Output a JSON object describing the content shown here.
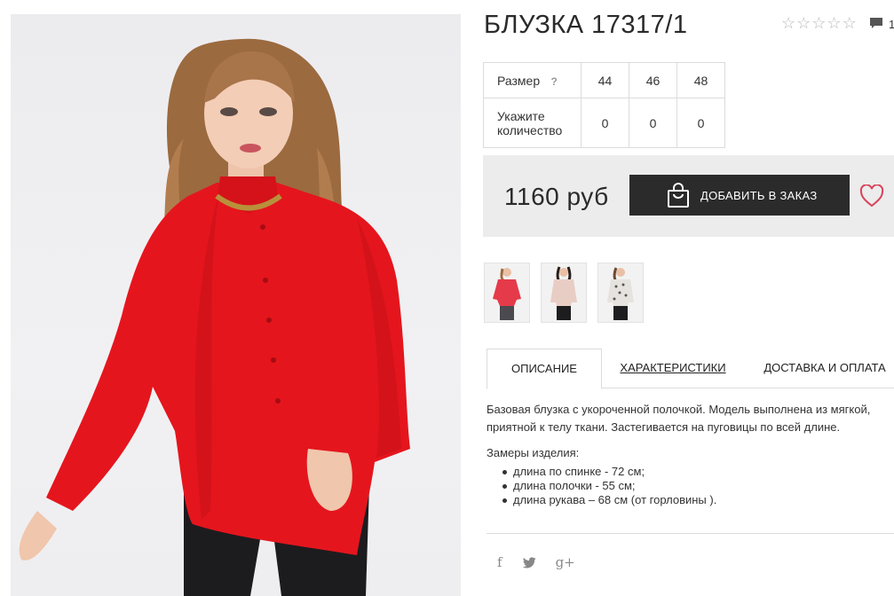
{
  "product": {
    "title": "БЛУЗКА 17317/1",
    "rating_stars": 5,
    "rating_filled": 0,
    "comment_count": "1"
  },
  "sizes": {
    "size_label": "Размер",
    "help_symbol": "?",
    "qty_label": "Укажите количество",
    "values": [
      "44",
      "46",
      "48"
    ],
    "quantities": [
      "0",
      "0",
      "0"
    ]
  },
  "purchase": {
    "price": "1160 руб",
    "add_button": "ДОБАВИТЬ В ЗАКАЗ"
  },
  "thumbnails": [
    {
      "name": "thumb-red-blouse"
    },
    {
      "name": "thumb-beige-blouse"
    },
    {
      "name": "thumb-printed-blouse"
    }
  ],
  "tabs": [
    {
      "label": "ОПИСАНИЕ",
      "active": true
    },
    {
      "label": "ХАРАКТЕРИСТИКИ",
      "active": false
    },
    {
      "label": "ДОСТАВКА И ОПЛАТА",
      "active": false
    }
  ],
  "description": {
    "text": "Базовая блузка с укороченной полочкой. Модель выполнена из мягкой, приятной к телу ткани. Застегивается на пуговицы по всей длине.",
    "measures_title": "Замеры изделия:",
    "measures": [
      "длина по спинке - 72 см;",
      "длина полочки - 55 см;",
      "длина рукава – 68 см (от горловины )."
    ]
  },
  "social": {
    "facebook": "f",
    "twitter": "twitter-icon",
    "googleplus": "g+"
  },
  "colors": {
    "accent": "#e2142d",
    "button": "#2b2b2b",
    "heart": "#d9435b",
    "price_bg": "#ececec"
  }
}
